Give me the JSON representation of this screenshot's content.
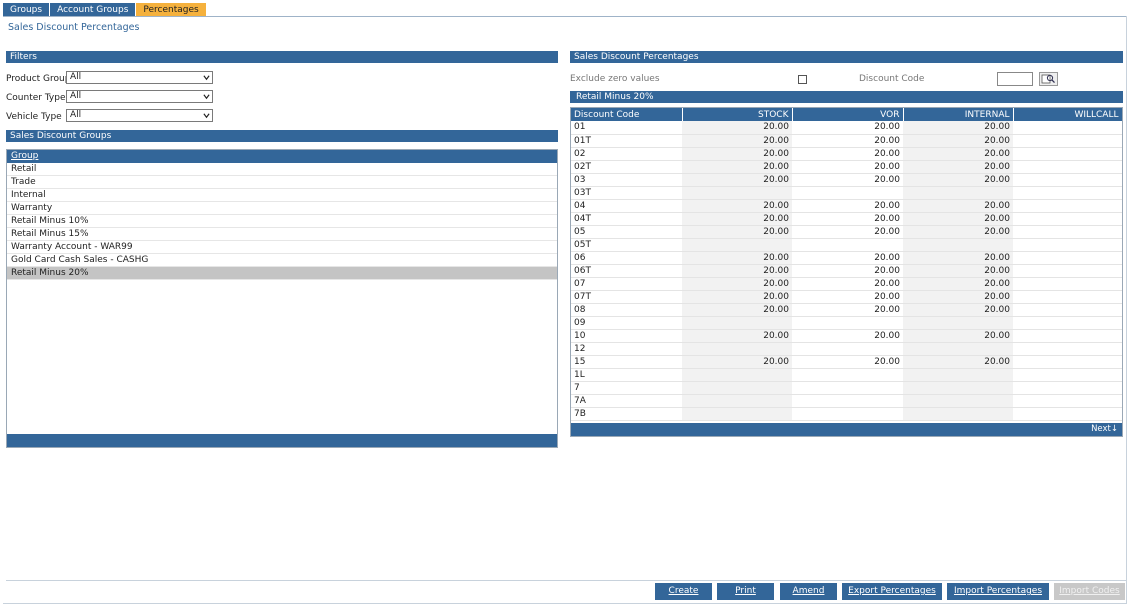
{
  "tabs": [
    {
      "label": "Groups",
      "active": false
    },
    {
      "label": "Account Groups",
      "active": false
    },
    {
      "label": "Percentages",
      "active": true
    }
  ],
  "page_title": "Sales Discount Percentages",
  "filters": {
    "title": "Filters",
    "fields": [
      {
        "label": "Product Group",
        "value": "All"
      },
      {
        "label": "Counter Type",
        "value": "All"
      },
      {
        "label": "Vehicle Type",
        "value": "All"
      }
    ]
  },
  "groups_panel": {
    "title": "Sales Discount Groups",
    "header": "Group",
    "rows": [
      "Retail",
      "Trade",
      "Internal",
      "Warranty",
      "Retail Minus 10%",
      "Retail Minus 15%",
      "Warranty Account - WAR99",
      "Gold Card Cash Sales - CASHG",
      "Retail Minus 20%"
    ],
    "selected": "Retail Minus 20%"
  },
  "percentages_panel": {
    "title": "Sales Discount Percentages",
    "exclude_zero_label": "Exclude zero values",
    "exclude_zero_checked": false,
    "discount_code_label": "Discount Code",
    "discount_code_value": "",
    "subtitle": "Retail Minus 20%",
    "columns": [
      "Discount Code",
      "STOCK",
      "VOR",
      "INTERNAL",
      "WILLCALL"
    ],
    "rows": [
      [
        "01",
        "20.00",
        "20.00",
        "20.00",
        ""
      ],
      [
        "01T",
        "20.00",
        "20.00",
        "20.00",
        ""
      ],
      [
        "02",
        "20.00",
        "20.00",
        "20.00",
        ""
      ],
      [
        "02T",
        "20.00",
        "20.00",
        "20.00",
        ""
      ],
      [
        "03",
        "20.00",
        "20.00",
        "20.00",
        ""
      ],
      [
        "03T",
        "",
        "",
        "",
        ""
      ],
      [
        "04",
        "20.00",
        "20.00",
        "20.00",
        ""
      ],
      [
        "04T",
        "20.00",
        "20.00",
        "20.00",
        ""
      ],
      [
        "05",
        "20.00",
        "20.00",
        "20.00",
        ""
      ],
      [
        "05T",
        "",
        "",
        "",
        ""
      ],
      [
        "06",
        "20.00",
        "20.00",
        "20.00",
        ""
      ],
      [
        "06T",
        "20.00",
        "20.00",
        "20.00",
        ""
      ],
      [
        "07",
        "20.00",
        "20.00",
        "20.00",
        ""
      ],
      [
        "07T",
        "20.00",
        "20.00",
        "20.00",
        ""
      ],
      [
        "08",
        "20.00",
        "20.00",
        "20.00",
        ""
      ],
      [
        "09",
        "",
        "",
        "",
        ""
      ],
      [
        "10",
        "20.00",
        "20.00",
        "20.00",
        ""
      ],
      [
        "12",
        "",
        "",
        "",
        ""
      ],
      [
        "15",
        "20.00",
        "20.00",
        "20.00",
        ""
      ],
      [
        "1L",
        "",
        "",
        "",
        ""
      ],
      [
        "7",
        "",
        "",
        "",
        ""
      ],
      [
        "7A",
        "",
        "",
        "",
        ""
      ],
      [
        "7B",
        "",
        "",
        "",
        ""
      ]
    ],
    "next_label": "Next"
  },
  "buttons": [
    {
      "label": "Create",
      "enabled": true
    },
    {
      "label": "Print",
      "enabled": true
    },
    {
      "label": "Amend",
      "enabled": true
    },
    {
      "label": "Export Percentages",
      "enabled": true
    },
    {
      "label": "Import Percentages",
      "enabled": true
    },
    {
      "label": "Import Codes",
      "enabled": false
    }
  ],
  "colors": {
    "accent": "#336699",
    "active_tab": "#f5b13d",
    "selected_row": "#c4c4c4",
    "disabled": "#c8c8c8"
  }
}
